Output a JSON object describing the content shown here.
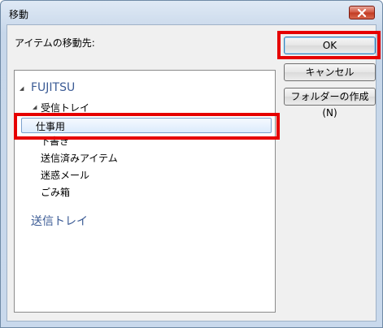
{
  "window": {
    "title": "移動"
  },
  "dialog": {
    "prompt": "アイテムの移動先:",
    "tree": {
      "root1": "FUJITSU",
      "inbox": "受信トレイ",
      "selected_folder": "仕事用",
      "drafts": "下書き",
      "sent_items": "送信済みアイテム",
      "junk": "迷惑メール",
      "trash": "ごみ箱",
      "root2": "送信トレイ"
    },
    "buttons": {
      "ok": "OK",
      "cancel": "キャンセル",
      "new_folder": "フォルダーの作成(N)"
    }
  },
  "colors": {
    "highlight": "#e60000",
    "root_folder_text": "#3b5b95",
    "selection_fill": "#dcebfc"
  },
  "icons": [
    "close-icon",
    "expanded-triangle-icon"
  ]
}
